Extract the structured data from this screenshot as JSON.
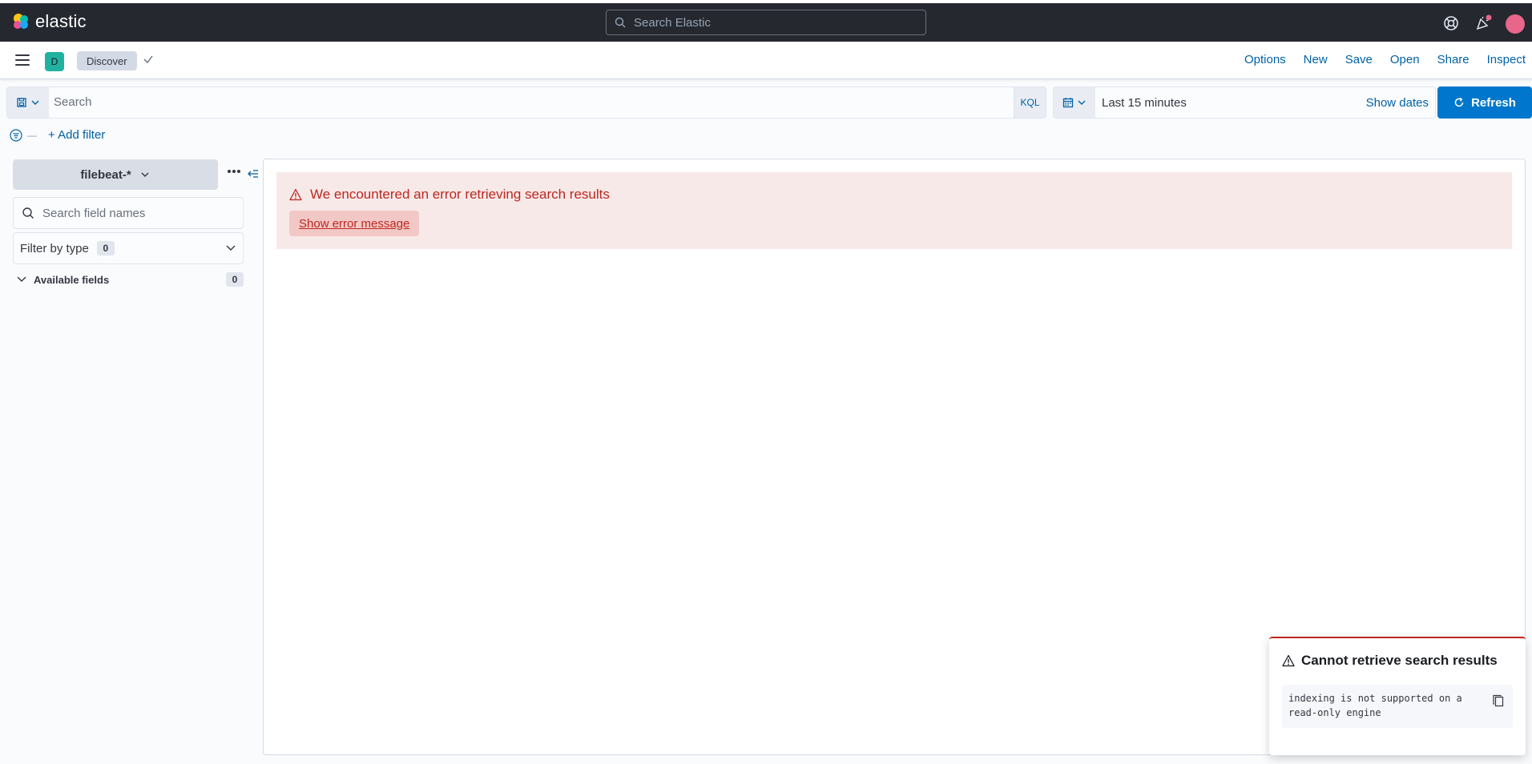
{
  "header": {
    "logo_text": "elastic",
    "global_search_placeholder": "Search Elastic",
    "icons": [
      "help-icon",
      "newsfeed-icon",
      "user-avatar"
    ],
    "colors": {
      "header_bg": "#25282f",
      "avatar": "#e7668a",
      "notification_dot": "#e7668a"
    }
  },
  "appbar": {
    "space_initial": "D",
    "breadcrumb": "Discover",
    "menu": [
      "Options",
      "New",
      "Save",
      "Open",
      "Share",
      "Inspect"
    ]
  },
  "querybar": {
    "placeholder": "Search",
    "language": "KQL",
    "time_range": "Last 15 minutes",
    "show_dates": "Show dates",
    "refresh_label": "Refresh"
  },
  "filters": {
    "add_filter": "+ Add filter"
  },
  "sidebar": {
    "index_pattern": "filebeat-*",
    "field_search_placeholder": "Search field names",
    "filter_by_type": "Filter by type",
    "filter_by_type_count": "0",
    "available_fields": "Available fields",
    "available_fields_count": "0"
  },
  "main": {
    "error_title": "We encountered an error retrieving search results",
    "show_error_label": "Show error message"
  },
  "toast": {
    "title": "Cannot retrieve search results",
    "message": "indexing is not supported on a read-only engine"
  }
}
